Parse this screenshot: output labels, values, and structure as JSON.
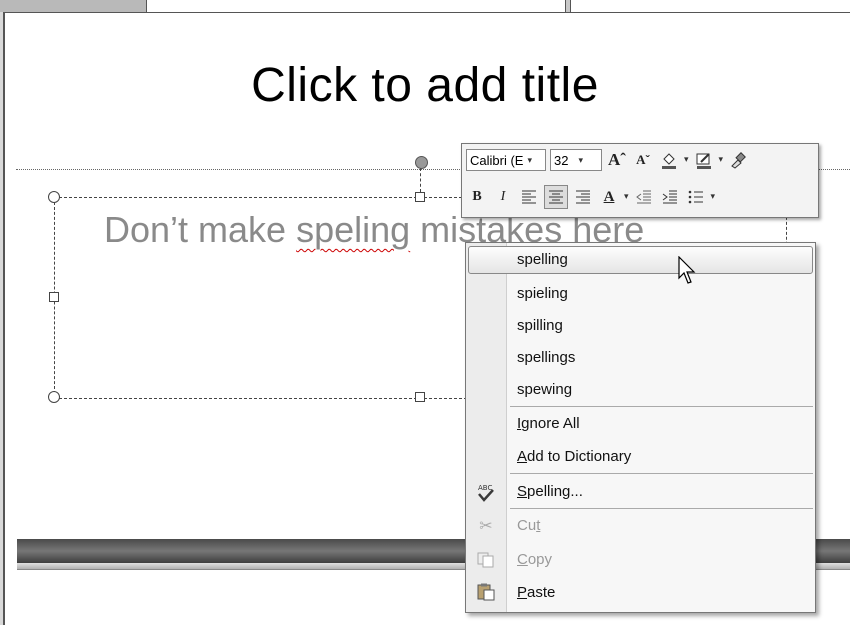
{
  "slide": {
    "title_placeholder": "Click to add title",
    "body_text_before": "Don’t make ",
    "body_misspelled": "speling",
    "body_text_after": " mistakes here"
  },
  "mini_toolbar": {
    "font_name": "Calibri (E",
    "font_size": "32",
    "grow_font_icon": "Aˆ",
    "shrink_font_icon": "Aˇ",
    "bold": "B",
    "italic": "I",
    "font_color_letter": "A"
  },
  "context_menu": {
    "suggestions": [
      "spelling",
      "spieling",
      "spilling",
      "spellings",
      "spewing"
    ],
    "ignore_all": {
      "prefix": "",
      "accel": "I",
      "rest": "gnore All"
    },
    "add_to_dictionary": {
      "prefix": "",
      "accel": "A",
      "rest": "dd to Dictionary"
    },
    "spelling": {
      "prefix": "",
      "accel": "S",
      "rest": "pelling..."
    },
    "cut": {
      "prefix": "Cu",
      "accel": "t",
      "rest": ""
    },
    "copy": {
      "prefix": "",
      "accel": "C",
      "rest": "opy"
    },
    "paste": {
      "prefix": "",
      "accel": "P",
      "rest": "aste"
    }
  },
  "icons": {
    "spelling": "spell-check-icon",
    "cut": "scissors-icon",
    "copy": "copy-icon",
    "paste": "paste-icon"
  }
}
